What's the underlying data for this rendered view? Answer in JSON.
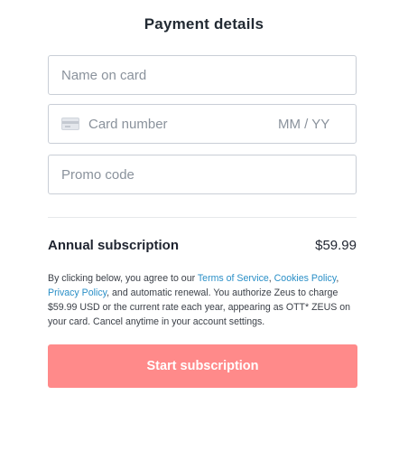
{
  "header": {
    "title": "Payment details"
  },
  "form": {
    "name_placeholder": "Name on card",
    "card_placeholder": "Card number",
    "expiry_placeholder": "MM / YY",
    "promo_placeholder": "Promo code"
  },
  "icons": {
    "card": "credit-card-icon"
  },
  "plan": {
    "name": "Annual subscription",
    "price": "$59.99"
  },
  "terms": {
    "prefix": "By clicking below, you agree to our ",
    "tos": "Terms of Service",
    "sep1": ", ",
    "cookies": "Cookies Policy",
    "sep2": ", ",
    "privacy": "Privacy Policy",
    "suffix": ", and automatic renewal. You authorize Zeus to charge $59.99 USD or the current rate each year, appearing as OTT* ZEUS on your card. Cancel anytime in your account settings."
  },
  "cta": {
    "label": "Start subscription",
    "color": "#ff8a8a"
  },
  "colors": {
    "link": "#2a8fc7",
    "border": "#c9ced6"
  }
}
